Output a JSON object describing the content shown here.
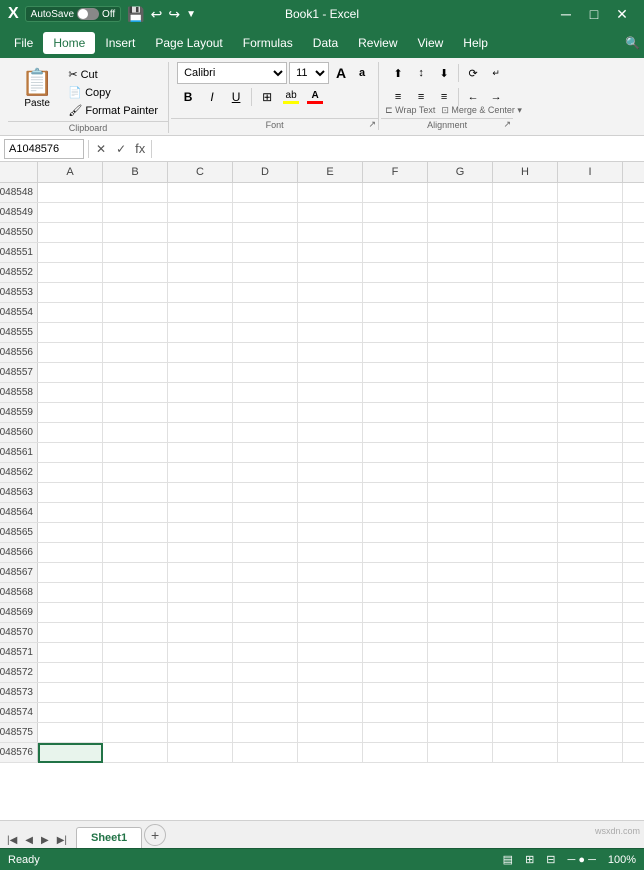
{
  "titleBar": {
    "autosave": "AutoSave",
    "autosave_state": "Off",
    "title": "Book1 - Excel",
    "save_icon": "💾",
    "undo_icon": "↩",
    "redo_icon": "↪",
    "customize_icon": "▼"
  },
  "menuBar": {
    "items": [
      "File",
      "Home",
      "Insert",
      "Page Layout",
      "Formulas",
      "Data",
      "Review",
      "View",
      "Help"
    ]
  },
  "ribbon": {
    "clipboard": {
      "label": "Clipboard",
      "paste": "Paste",
      "cut": "✂ Cut",
      "copy": "Copy",
      "format_painter": "Format Painter"
    },
    "font": {
      "label": "Font",
      "name": "Calibri",
      "size": "11",
      "increase": "A",
      "decrease": "a",
      "bold": "B",
      "italic": "I",
      "underline": "U",
      "highlight_color": "#FFFF00",
      "font_color": "#FF0000"
    },
    "alignment": {
      "label": "Alignment",
      "wrap_text": "Wrap Text",
      "merge_center": "Merge & Center"
    }
  },
  "formulaBar": {
    "nameBox": "A1048576",
    "cancelLabel": "✕",
    "confirmLabel": "✓",
    "functionLabel": "fx",
    "formula": ""
  },
  "columns": [
    "A",
    "B",
    "C",
    "D",
    "E",
    "F",
    "G",
    "H",
    "I"
  ],
  "rows": [
    "048548",
    "048549",
    "048550",
    "048551",
    "048552",
    "048553",
    "048554",
    "048555",
    "048556",
    "048557",
    "048558",
    "048559",
    "048560",
    "048561",
    "048562",
    "048563",
    "048564",
    "048565",
    "048566",
    "048567",
    "048568",
    "048569",
    "048570",
    "048571",
    "048572",
    "048573",
    "048574",
    "048575",
    "048576"
  ],
  "selectedCell": "A1048576",
  "sheetTabs": {
    "sheets": [
      "Sheet1"
    ],
    "active": "Sheet1"
  },
  "statusBar": {
    "status": "Ready",
    "watermark": "wsxdn.com"
  }
}
